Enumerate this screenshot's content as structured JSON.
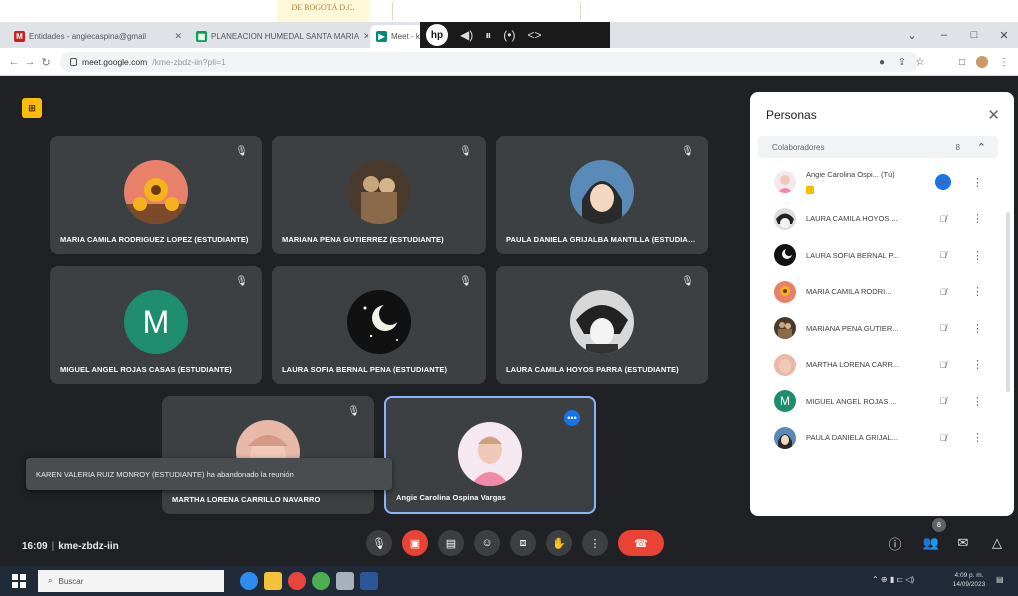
{
  "doc_strip": {
    "note_line1": "DE BOGOTÁ D.C."
  },
  "browser": {
    "tabs": [
      {
        "title": "Entidades - angiecaspina@gmail",
        "favicon_color": "#c5221f",
        "favicon_letter": "M"
      },
      {
        "title": "PLANEACION HUMEDAL SANTA MARIA",
        "favicon_color": "#0f9d58",
        "favicon_letter": "▦"
      },
      {
        "title": "Meet - kme-zbdz-iin",
        "favicon_color": "#00897b",
        "favicon_letter": "▶"
      }
    ],
    "hp_label": "hp",
    "url_host": "meet.google.com",
    "url_path": "/kme-zbdz-iin?pli=1"
  },
  "meet": {
    "code": "kme-zbdz-iin",
    "time": "16:09",
    "tiles": [
      {
        "name": "MARIA CAMILA RODRIGUEZ LOPEZ (ESTUDIANTE)",
        "avatar": "sunflower"
      },
      {
        "name": "MARIANA PENA GUTIERREZ (ESTUDIANTE)",
        "avatar": "couple"
      },
      {
        "name": "PAULA DANIELA GRIJALBA MANTILLA (ESTUDIANTE)",
        "avatar": "anime"
      },
      {
        "name": "MIGUEL ANGEL ROJAS CASAS (ESTUDIANTE)",
        "avatar": "letter",
        "letter": "M"
      },
      {
        "name": "LAURA SOFIA BERNAL PENA (ESTUDIANTE)",
        "avatar": "moon"
      },
      {
        "name": "LAURA CAMILA HOYOS PARRA (ESTUDIANTE)",
        "avatar": "bw"
      },
      {
        "name": "MARTHA LORENA CARRILLO NAVARRO",
        "avatar": "pink"
      },
      {
        "name": "Angie Carolina Ospina Vargas",
        "avatar": "self"
      }
    ],
    "toast": "KAREN VALERIA RUIZ MONROY (ESTUDIANTE) ha abandonado la reunión",
    "people_count": "8"
  },
  "panel": {
    "title": "Personas",
    "group_label": "Colaboradores",
    "group_count": "8",
    "participants": [
      {
        "name": "Angie Carolina Ospi... (Tú)",
        "avatar": "self"
      },
      {
        "name": "LAURA CAMILA HOYOS ...",
        "avatar": "bw"
      },
      {
        "name": "LAURA SOFIA BERNAL P...",
        "avatar": "moon"
      },
      {
        "name": "MARIA CAMILA RODRI...",
        "avatar": "sunflower"
      },
      {
        "name": "MARIANA PENA GUTIER...",
        "avatar": "couple"
      },
      {
        "name": "MARTHA LORENA CARR...",
        "avatar": "pink"
      },
      {
        "name": "MIGUEL ANGEL ROJAS ...",
        "avatar": "letter",
        "letter": "M"
      },
      {
        "name": "PAULA DANIELA GRIJAL...",
        "avatar": "anime"
      }
    ]
  },
  "taskbar": {
    "search_placeholder": "Buscar",
    "clock_time": "4:09 p. m.",
    "clock_date": "14/09/2023"
  },
  "colors": {
    "stage": "#202124",
    "tile": "#3c4043",
    "hangup": "#ea4335",
    "accent": "#1a73e8",
    "logo": "#fbbc04"
  }
}
